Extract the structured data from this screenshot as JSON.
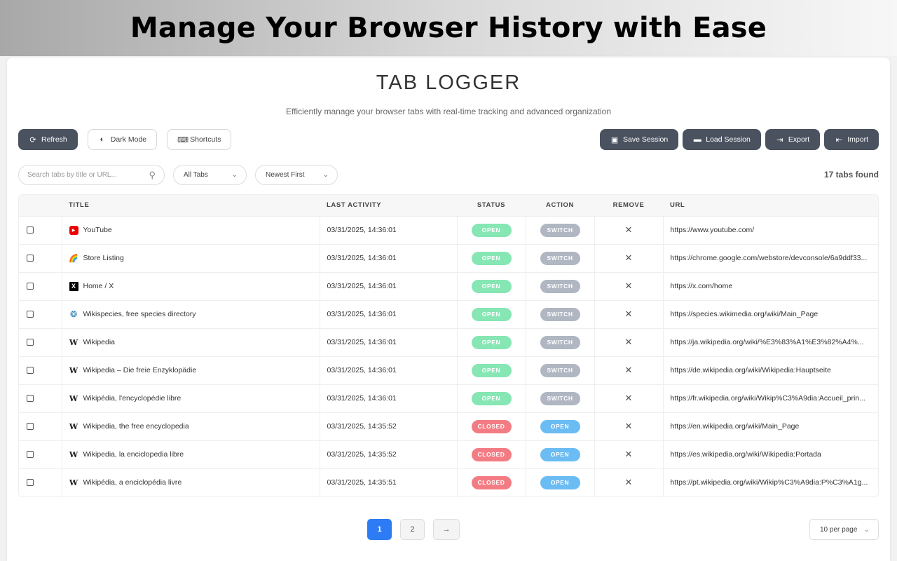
{
  "banner": {
    "title": "Manage Your Browser History with Ease"
  },
  "app": {
    "title": "TAB LOGGER",
    "subtitle": "Efficiently manage your browser tabs with real-time tracking and advanced organization"
  },
  "toolbar": {
    "refresh": {
      "label": "Refresh",
      "icon": "refresh-icon"
    },
    "dark_mode": {
      "label": "Dark Mode",
      "icon": "half-circle-icon"
    },
    "shortcuts": {
      "label": "Shortcuts",
      "icon": "keyboard-icon"
    },
    "save_session": {
      "label": "Save Session",
      "icon": "floppy-icon"
    },
    "load_session": {
      "label": "Load Session",
      "icon": "folder-icon"
    },
    "export": {
      "label": "Export",
      "icon": "file-export-icon"
    },
    "import": {
      "label": "Import",
      "icon": "file-import-icon"
    }
  },
  "filters": {
    "search_placeholder": "Search tabs by title or URL...",
    "tab_filter": "All Tabs",
    "sort": "Newest First",
    "count_text": "17 tabs found"
  },
  "table": {
    "headers": {
      "title": "TITLE",
      "last_activity": "LAST ACTIVITY",
      "status": "STATUS",
      "action": "ACTION",
      "remove": "REMOVE",
      "url": "URL"
    },
    "remove_glyph": "✕",
    "rows": [
      {
        "favicon": "youtube-icon",
        "title": "YouTube",
        "time": "03/31/2025, 14:36:01",
        "status": "OPEN",
        "action": "SWITCH",
        "url": "https://www.youtube.com/"
      },
      {
        "favicon": "rainbow-icon",
        "title": "Store Listing",
        "time": "03/31/2025, 14:36:01",
        "status": "OPEN",
        "action": "SWITCH",
        "url": "https://chrome.google.com/webstore/devconsole/6a9ddf33..."
      },
      {
        "favicon": "x-logo-icon",
        "title": "Home / X",
        "time": "03/31/2025, 14:36:01",
        "status": "OPEN",
        "action": "SWITCH",
        "url": "https://x.com/home"
      },
      {
        "favicon": "wikispecies-icon",
        "title": "Wikispecies, free species directory",
        "time": "03/31/2025, 14:36:01",
        "status": "OPEN",
        "action": "SWITCH",
        "url": "https://species.wikimedia.org/wiki/Main_Page"
      },
      {
        "favicon": "wikipedia-icon",
        "title": "Wikipedia",
        "time": "03/31/2025, 14:36:01",
        "status": "OPEN",
        "action": "SWITCH",
        "url": "https://ja.wikipedia.org/wiki/%E3%83%A1%E3%82%A4%..."
      },
      {
        "favicon": "wikipedia-icon",
        "title": "Wikipedia – Die freie Enzyklopädie",
        "time": "03/31/2025, 14:36:01",
        "status": "OPEN",
        "action": "SWITCH",
        "url": "https://de.wikipedia.org/wiki/Wikipedia:Hauptseite"
      },
      {
        "favicon": "wikipedia-icon",
        "title": "Wikipédia, l'encyclopédie libre",
        "time": "03/31/2025, 14:36:01",
        "status": "OPEN",
        "action": "SWITCH",
        "url": "https://fr.wikipedia.org/wiki/Wikip%C3%A9dia:Accueil_prin..."
      },
      {
        "favicon": "wikipedia-icon",
        "title": "Wikipedia, the free encyclopedia",
        "time": "03/31/2025, 14:35:52",
        "status": "CLOSED",
        "action": "OPEN",
        "url": "https://en.wikipedia.org/wiki/Main_Page"
      },
      {
        "favicon": "wikipedia-icon",
        "title": "Wikipedia, la enciclopedia libre",
        "time": "03/31/2025, 14:35:52",
        "status": "CLOSED",
        "action": "OPEN",
        "url": "https://es.wikipedia.org/wiki/Wikipedia:Portada"
      },
      {
        "favicon": "wikipedia-icon",
        "title": "Wikipédia, a enciclopédia livre",
        "time": "03/31/2025, 14:35:51",
        "status": "CLOSED",
        "action": "OPEN",
        "url": "https://pt.wikipedia.org/wiki/Wikip%C3%A9dia:P%C3%A1g..."
      }
    ]
  },
  "pagination": {
    "pages": [
      "1",
      "2"
    ],
    "current": "1",
    "next_glyph": "→",
    "per_page": "10 per page"
  },
  "colors": {
    "accent": "#2d7cf6",
    "dark_button": "#4a5260",
    "status_open": "#86e6b4",
    "status_closed": "#f37c84",
    "action_switch": "#b0b6c2",
    "action_open": "#6bbcf2"
  }
}
